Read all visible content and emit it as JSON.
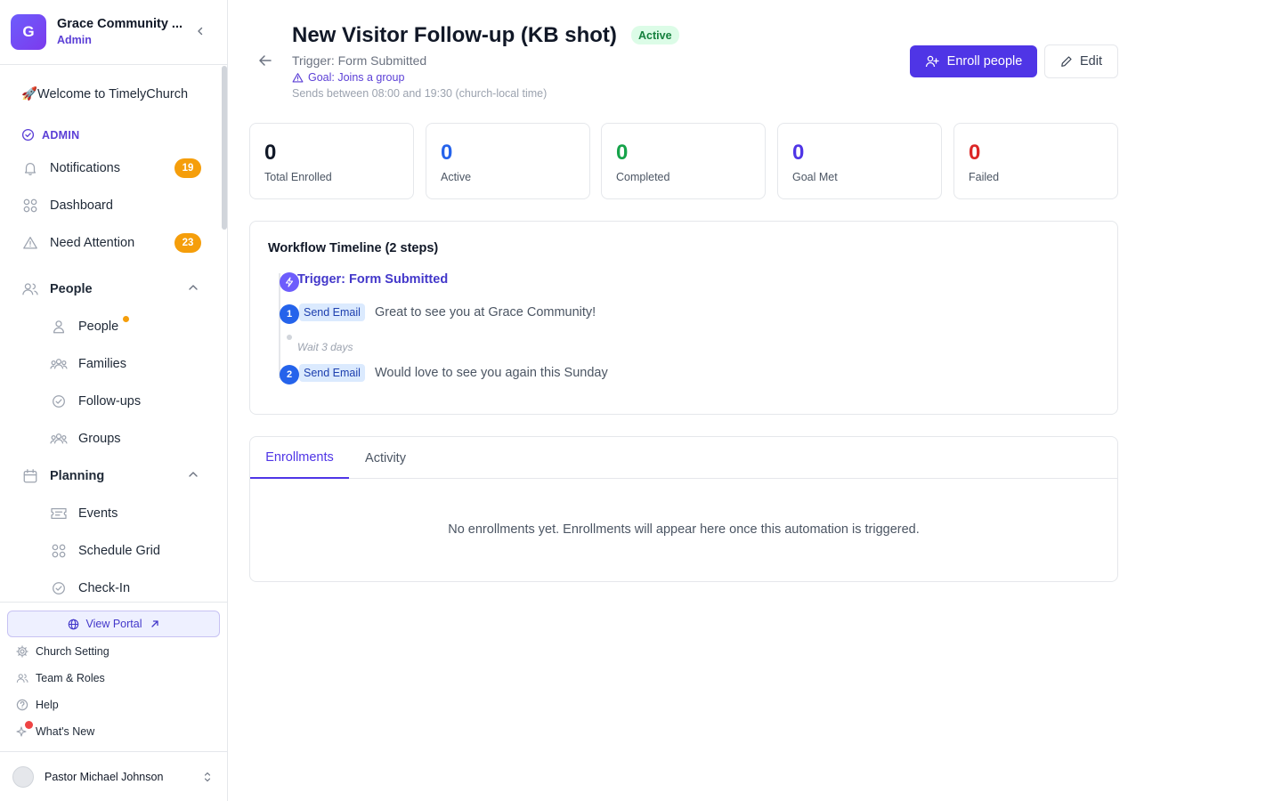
{
  "sidebar": {
    "org_initial": "G",
    "org_name": "Grace Community ...",
    "org_role": "Admin",
    "welcome": "🚀Welcome to TimelyChurch",
    "admin_label": "ADMIN",
    "items": {
      "notifications": {
        "label": "Notifications",
        "badge": "19"
      },
      "dashboard": {
        "label": "Dashboard"
      },
      "need_attention": {
        "label": "Need Attention",
        "badge": "23"
      },
      "people_section": {
        "label": "People"
      },
      "people": {
        "label": "People"
      },
      "families": {
        "label": "Families"
      },
      "followups": {
        "label": "Follow-ups"
      },
      "groups": {
        "label": "Groups"
      },
      "planning_section": {
        "label": "Planning"
      },
      "events": {
        "label": "Events"
      },
      "schedule_grid": {
        "label": "Schedule Grid"
      },
      "checkin": {
        "label": "Check-In"
      }
    },
    "portal_label": "View Portal",
    "utility": {
      "church_setting": "Church Setting",
      "team_roles": "Team & Roles",
      "help": "Help",
      "whats_new": "What's New"
    },
    "user_name": "Pastor Michael Johnson"
  },
  "header": {
    "title": "New Visitor Follow-up (KB shot)",
    "status": "Active",
    "trigger": "Trigger: Form Submitted",
    "goal": "Goal: Joins a group",
    "sends": "Sends between 08:00 and 19:30 (church-local time)",
    "enroll_label": "Enroll people",
    "edit_label": "Edit"
  },
  "stats": [
    {
      "value": "0",
      "label": "Total Enrolled",
      "color": "#111827"
    },
    {
      "value": "0",
      "label": "Active",
      "color": "#2563eb"
    },
    {
      "value": "0",
      "label": "Completed",
      "color": "#16a34a"
    },
    {
      "value": "0",
      "label": "Goal Met",
      "color": "#4f35e6"
    },
    {
      "value": "0",
      "label": "Failed",
      "color": "#dc2626"
    }
  ],
  "timeline": {
    "title": "Workflow Timeline (2 steps)",
    "trigger": "Trigger: Form Submitted",
    "steps": [
      {
        "num": "1",
        "type": "Send Email",
        "text": "Great to see you at Grace Community!"
      },
      {
        "num": "2",
        "type": "Send Email",
        "text": "Would love to see you again this Sunday"
      }
    ],
    "wait": "Wait 3 days"
  },
  "tabs": {
    "items": [
      "Enrollments",
      "Activity"
    ],
    "active": "Enrollments",
    "empty_message": "No enrollments yet. Enrollments will appear here once this automation is triggered."
  },
  "colors": {
    "accent": "#4f35e6",
    "badge_orange": "#f59e0b",
    "status_green_bg": "#dcfce7",
    "status_green_text": "#15803d"
  }
}
